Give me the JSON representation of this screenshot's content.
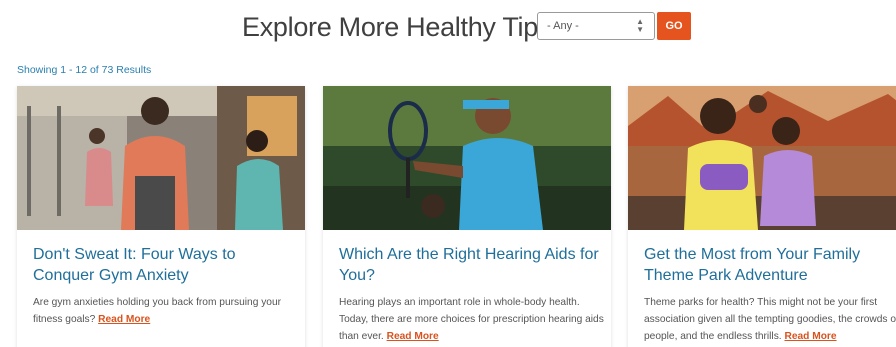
{
  "header": {
    "title": "Explore More Healthy Tips",
    "filter_value": "- Any -",
    "go_label": "GO"
  },
  "results_text": "Showing 1 - 12 of 73 Results",
  "cards": [
    {
      "title": "Don't Sweat It: Four Ways to Conquer Gym Anxiety",
      "description": "Are gym anxieties holding you back from pursuing your fitness goals?",
      "read_more": "Read More"
    },
    {
      "title": "Which Are the Right Hearing Aids for You?",
      "description": "Hearing plays an important role in whole-body health. Today, there are more choices for prescription hearing aids than ever.",
      "read_more": "Read More"
    },
    {
      "title": "Get the Most from Your Family Theme Park Adventure",
      "description": "Theme parks for health? This might not be your first association given all the tempting goodies, the crowds of people, and the endless thrills.",
      "read_more": "Read More"
    }
  ],
  "colors": {
    "accent": "#e5541e",
    "link": "#1f6f9a",
    "results": "#2a7fae"
  }
}
